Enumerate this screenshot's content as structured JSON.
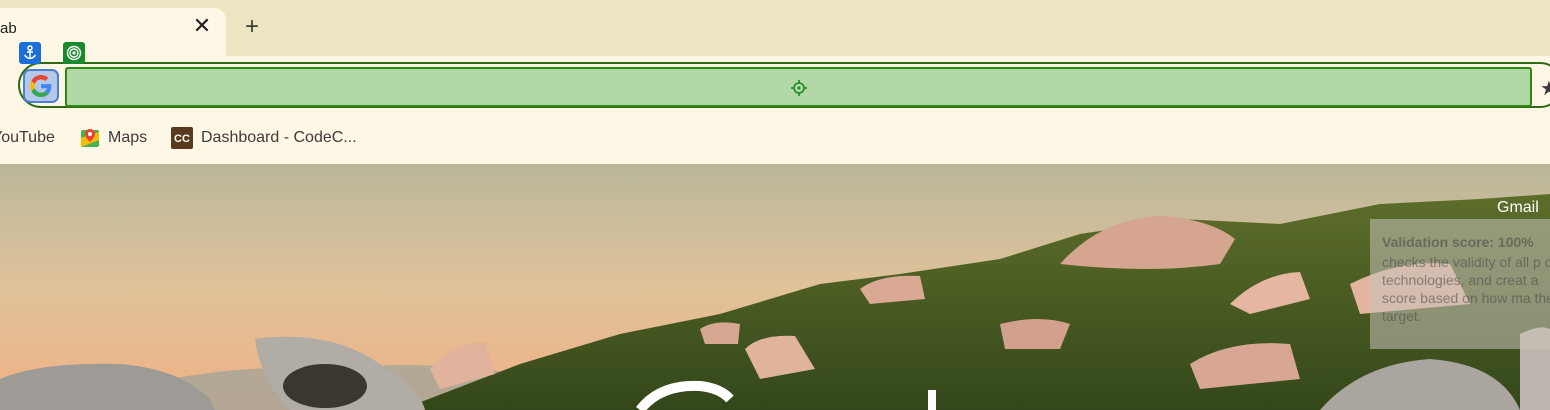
{
  "tabs": [
    {
      "title": "ab",
      "active": true
    }
  ],
  "tab_close_glyph": "✕",
  "new_tab_glyph": "+",
  "overlay_labels": {
    "anchor_icon": "anchor-icon",
    "target_icon": "target-icon"
  },
  "omnibox": {
    "provider_icon": "google-g-icon",
    "value": "",
    "crosshair_icon": "crosshair-icon",
    "bookmark_star_glyph": "★"
  },
  "bookmarks": [
    {
      "label": "YouTube",
      "icon": "youtube-icon"
    },
    {
      "label": "Maps",
      "icon": "maps-icon"
    },
    {
      "label": "Dashboard - CodeC...",
      "icon": "codec-icon"
    }
  ],
  "page": {
    "gmail_label": "Gmail",
    "tooltip": {
      "heading": "Validation score: 100%",
      "body": "checks the validity of all p of technologies, and creat a score based on how ma the target."
    }
  },
  "colors": {
    "tabstrip": "#ebe5c2",
    "toolbar": "#fff7e6",
    "omnibox_highlight": "#b3d8a8",
    "omnibox_border": "#2b8a10",
    "anchor_label": "#1a6fd8",
    "target_label": "#188a2e"
  }
}
